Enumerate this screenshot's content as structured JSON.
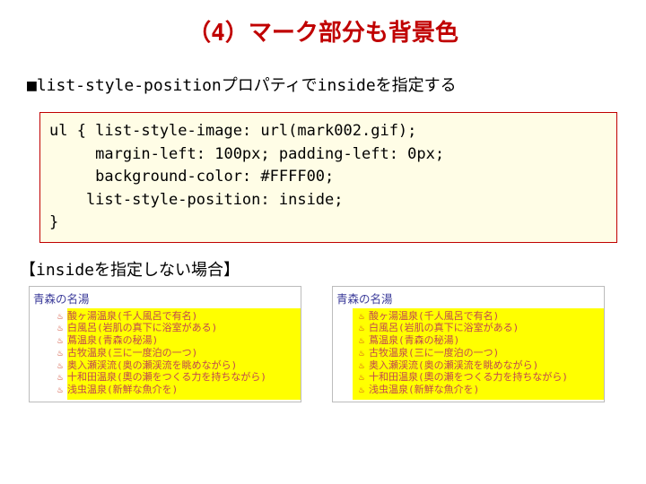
{
  "title": "（4）マーク部分も背景色",
  "subtitle": "■list-style-positionプロパティでinsideを指定する",
  "code": "ul { list-style-image: url(mark002.gif);\n     margin-left: 100px; padding-left: 0px;\n     background-color: #FFFF00;\n    list-style-position: inside;\n}",
  "note": "【insideを指定しない場合】",
  "example_left": {
    "header": "青森の名湯",
    "items": [
      "酸ヶ湯温泉(千人風呂で有名)",
      "白風呂(岩肌の真下に浴室がある)",
      "蔦温泉(青森の秘湯)",
      "古牧温泉(三に一度泊の一つ)",
      "奥入瀬渓流(奥の瀬渓流を眺めながら)",
      "十和田温泉(奧の瀬をつくる力を持ちながら)",
      "浅虫温泉(新鮮な魚介を)"
    ]
  },
  "example_right": {
    "header": "青森の名湯",
    "items": [
      "酸ヶ湯温泉(千人風呂で有名)",
      "白風呂(岩肌の真下に浴室がある)",
      "蔦温泉(青森の秘湯)",
      "古牧温泉(三に一度泊の一つ)",
      "奥入瀬渓流(奥の瀬渓流を眺めながら)",
      "十和田温泉(奧の瀬をつくる力を持ちながら)",
      "浅虫温泉(新鮮な魚介を)"
    ]
  },
  "marker": "♨",
  "colors": {
    "accent": "#c00000",
    "highlight": "#ffff00"
  }
}
